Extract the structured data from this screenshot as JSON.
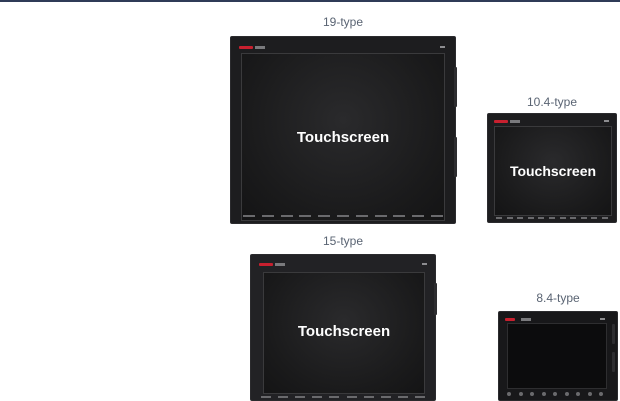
{
  "panels": [
    {
      "type_label": "19-type",
      "screen_label": "Touchscreen"
    },
    {
      "type_label": "10.4-type",
      "screen_label": "Touchscreen"
    },
    {
      "type_label": "15-type",
      "screen_label": "Touchscreen"
    },
    {
      "type_label": "8.4-type",
      "screen_label": ""
    }
  ],
  "colors": {
    "rule": "#2f3b57",
    "caption": "#5a6473",
    "bezel": "#1d1d1f",
    "logo_red": "#c8202f"
  }
}
